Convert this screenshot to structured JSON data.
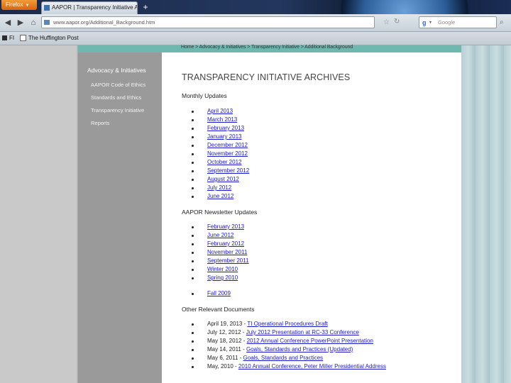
{
  "browser": {
    "app_button": "Firefox",
    "tab_title": "AAPOR | Transparency Initiative Archives",
    "new_tab": "+",
    "url": "www.aapor.org/Additional_Background.htm",
    "search_placeholder": "Google",
    "bookmarks": [
      "FI",
      "The Huffington Post"
    ]
  },
  "breadcrumb": "Home > Advocacy & Initiatives > Transparency Initiative > Additional Background",
  "sidebar": {
    "heading": "Advocacy & Initiatives",
    "items": [
      {
        "label": "AAPOR Code of Ethics"
      },
      {
        "label": "Standards and Ethics"
      },
      {
        "label": "Transparency Initiative"
      },
      {
        "label": "Reports"
      }
    ]
  },
  "main": {
    "title": "TRANSPARENCY INITIATIVE ARCHIVES",
    "monthly": {
      "heading": "Monthly Updates",
      "items": [
        "April 2013",
        "March 2013",
        "February 2013",
        "January 2013",
        "December 2012",
        "November 2012",
        "October 2012",
        "September 2012",
        "August 2012",
        "July 2012",
        "June 2012"
      ]
    },
    "newsletter": {
      "heading": "AAPOR Newsletter Updates",
      "items": [
        "February 2013",
        "June 2012",
        "February 2012",
        "November 2011",
        "September 2011",
        "Winter 2010",
        "Spring 2010"
      ],
      "extra": [
        "Fall 2009"
      ]
    },
    "other": {
      "heading": "Other Relevant Documents",
      "items": [
        {
          "date": "April 19, 2013 - ",
          "link": "TI Operational Procedures Draft"
        },
        {
          "date": "July 12, 2012 - ",
          "link": "July 2012 Presentation at RC-33 Conference"
        },
        {
          "date": "May 18, 2012 - ",
          "link": "2012 Annual Conference PowerPoint Presentation"
        },
        {
          "date": "May 14, 2011 - ",
          "link": "Goals, Standards and Practices (Updated)"
        },
        {
          "date": "May 6, 2011 - ",
          "link": "Goals, Standards and Practices"
        },
        {
          "date": "May, 2010 - ",
          "link": "2010 Annual Conference, Peter Miller Presidential Address"
        }
      ]
    }
  }
}
